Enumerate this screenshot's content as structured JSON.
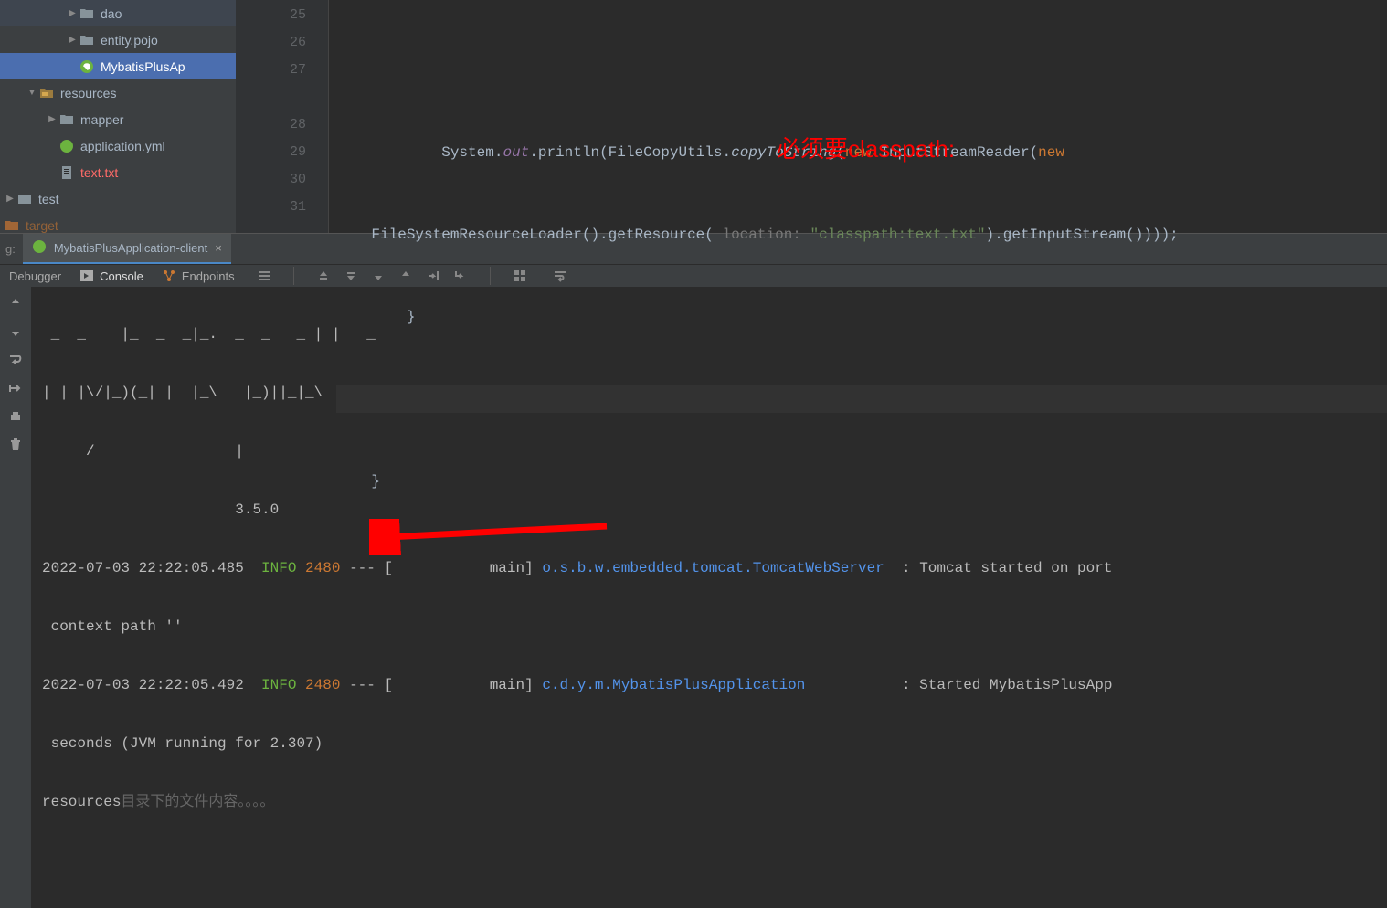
{
  "sidebar": {
    "items": [
      {
        "label": "dao",
        "type": "folder",
        "indent": 3
      },
      {
        "label": "entity.pojo",
        "type": "folder",
        "indent": 3
      },
      {
        "label": "MybatisPlusAp",
        "type": "class",
        "indent": 3,
        "selected": true
      },
      {
        "label": "resources",
        "type": "resources",
        "indent": 1,
        "expanded": true
      },
      {
        "label": "mapper",
        "type": "folder",
        "indent": 2
      },
      {
        "label": "application.yml",
        "type": "yml",
        "indent": 2
      },
      {
        "label": "text.txt",
        "type": "txt",
        "indent": 2,
        "highlight": true
      },
      {
        "label": "test",
        "type": "folder",
        "indent": 0
      },
      {
        "label": "target",
        "type": "target",
        "indent": 0
      }
    ]
  },
  "editor": {
    "lines": [
      25,
      26,
      27,
      28,
      29,
      30,
      31
    ],
    "code": {
      "l27a": "System.",
      "l27b": "out",
      "l27c": ".println(FileCopyUtils.",
      "l27d": "copyToString",
      "l27e": "(",
      "l27f": "new",
      "l27g": " InputStreamReader(",
      "l27h": "new",
      "l27_2a": "FileSystemResourceLoader().getResource(",
      "l27_2hint": " location: ",
      "l27_2str": "\"classpath:text.txt\"",
      "l27_2b": ").getInputStream())));",
      "l28": "        }",
      "l30": "    }"
    },
    "annotation": "必须要classpath:"
  },
  "run": {
    "prefix": "g:",
    "tab_label": "MybatisPlusApplication-client"
  },
  "debug_tabs": {
    "debugger": "Debugger",
    "console": "Console",
    "endpoints": "Endpoints"
  },
  "console": {
    "banner1": " _  _    |_  _  _|_.  _  _   _ | |   _",
    "banner2": "| | |\\/|_)(_| |  |_\\   |_)||_|_\\",
    "banner3": "     /                |",
    "version": "                      3.5.0",
    "log1_ts": "2022-07-03 22:22:05.485  ",
    "log1_level": "INFO",
    "log1_pid": " 2480",
    "log1_mid": " --- [           main] ",
    "log1_class": "o.s.b.w.embedded.tomcat.TomcatWebServer",
    "log1_msg": "  : Tomcat started on port",
    "log1_cont": " context path ''",
    "log2_ts": "2022-07-03 22:22:05.492  ",
    "log2_level": "INFO",
    "log2_pid": " 2480",
    "log2_mid": " --- [           main] ",
    "log2_class": "c.d.y.m.MybatisPlusApplication",
    "log2_msg": "           : Started MybatisPlusApp",
    "log2_cont": " seconds (JVM running for 2.307)",
    "output_a": "resources",
    "output_b": "目录下的文件内容。。。。"
  }
}
